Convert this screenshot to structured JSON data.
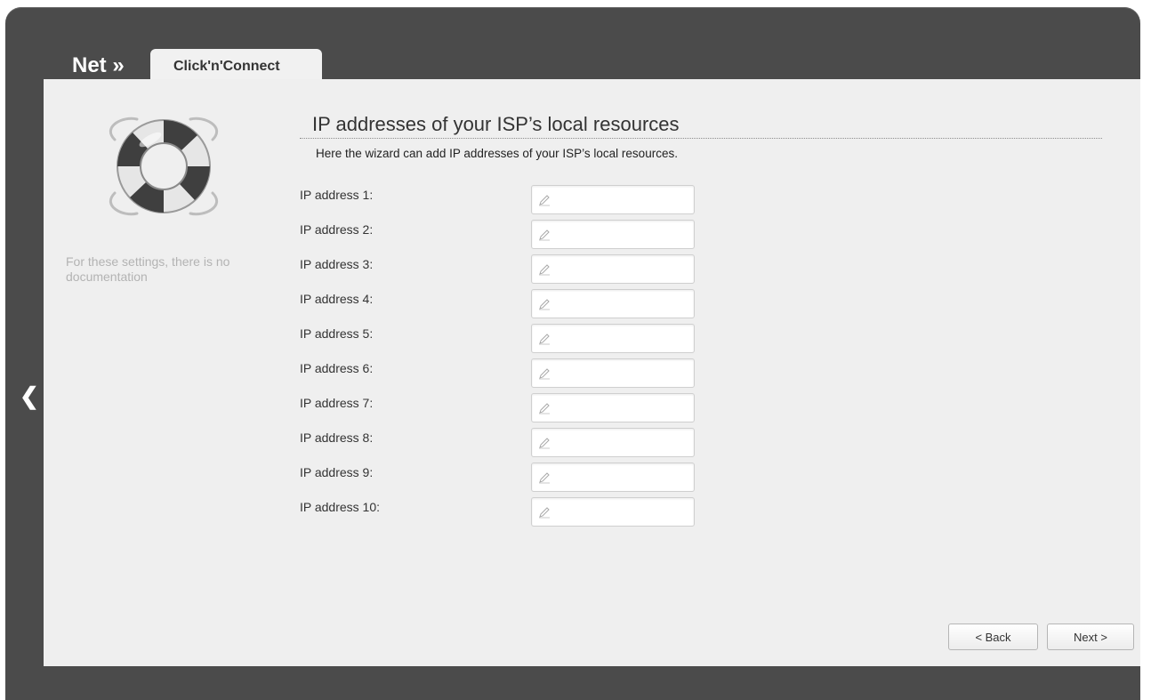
{
  "header": {
    "title": "Net »",
    "tab_label": "Click'n'Connect"
  },
  "sidebar": {
    "doc_note": "For these settings, there is no documentation"
  },
  "main": {
    "heading": "IP addresses of your ISP’s local resources",
    "subtitle": "Here the wizard can add IP addresses of your ISP’s local resources.",
    "fields": [
      {
        "label": "IP address 1:",
        "value": ""
      },
      {
        "label": "IP address 2:",
        "value": ""
      },
      {
        "label": "IP address 3:",
        "value": ""
      },
      {
        "label": "IP address 4:",
        "value": ""
      },
      {
        "label": "IP address 5:",
        "value": ""
      },
      {
        "label": "IP address 6:",
        "value": ""
      },
      {
        "label": "IP address 7:",
        "value": ""
      },
      {
        "label": "IP address 8:",
        "value": ""
      },
      {
        "label": "IP address 9:",
        "value": ""
      },
      {
        "label": "IP address 10:",
        "value": ""
      }
    ]
  },
  "footer": {
    "back_label": "< Back",
    "next_label": "Next >"
  },
  "icons": {
    "nav": "chevron-left-icon",
    "help": "lifebuoy-icon",
    "field": "pencil-icon"
  },
  "colors": {
    "frame": "#4b4b4b",
    "panel": "#efefef",
    "tab": "#f1f1f1"
  }
}
